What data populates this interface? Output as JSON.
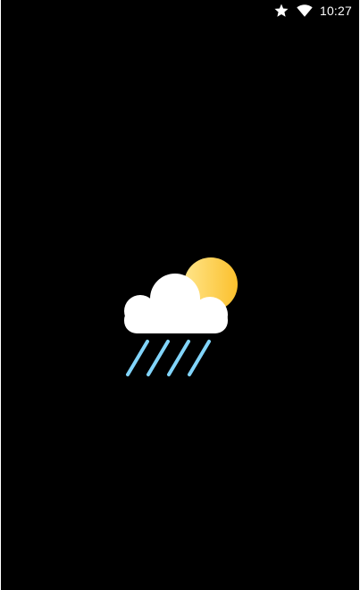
{
  "status_bar": {
    "time": "10:27",
    "icons": [
      "star-icon",
      "wifi-icon"
    ]
  },
  "splash": {
    "logo_icon": "weather-rain-sun-icon"
  },
  "colors": {
    "background": "#000000",
    "sun_start": "#FFD54F",
    "sun_end": "#FBC02D",
    "cloud": "#FFFFFF",
    "rain": "#81D4FA"
  }
}
